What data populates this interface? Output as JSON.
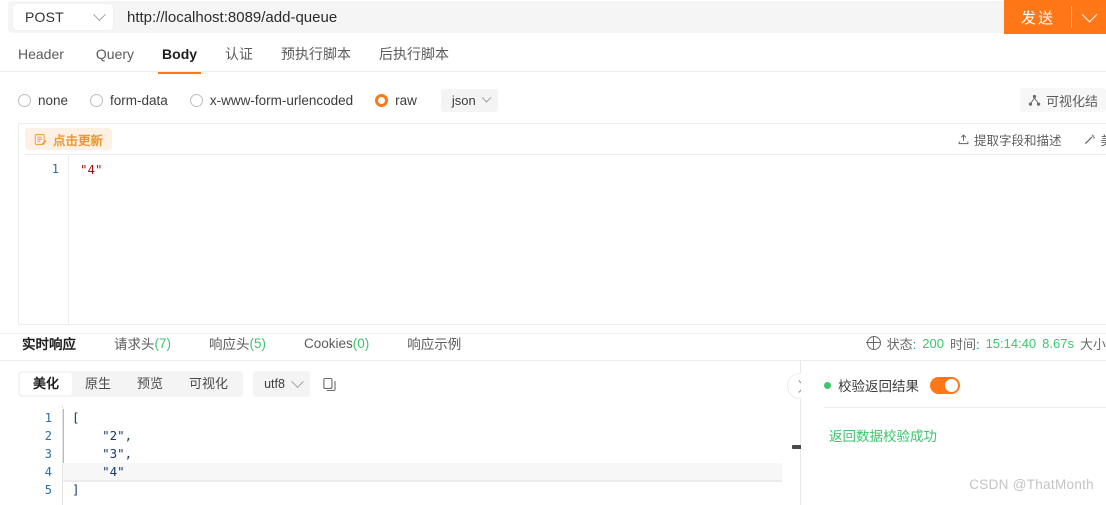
{
  "request": {
    "method": "POST",
    "url": "http://localhost:8089/add-queue",
    "send_label": "发送",
    "tabs": [
      {
        "label": "Header",
        "active": false
      },
      {
        "label": "Query",
        "active": false
      },
      {
        "label": "Body",
        "active": true
      },
      {
        "label": "认证",
        "active": false
      },
      {
        "label": "预执行脚本",
        "active": false
      },
      {
        "label": "后执行脚本",
        "active": false
      }
    ],
    "body_types": [
      {
        "label": "none",
        "selected": false
      },
      {
        "label": "form-data",
        "selected": false
      },
      {
        "label": "x-www-form-urlencoded",
        "selected": false
      },
      {
        "label": "raw",
        "selected": true
      }
    ],
    "raw_format": "json",
    "visualize_result_label": "可视化结",
    "editor": {
      "update_button_label": "点击更新",
      "extract_fields_label": "提取字段和描述",
      "beautify_label": "美",
      "lines": [
        {
          "number": "1",
          "text": "\"4\"",
          "type": "string"
        }
      ]
    }
  },
  "response": {
    "tabs": [
      {
        "label": "实时响应",
        "count": "",
        "active": true
      },
      {
        "label": "请求头",
        "count": "(7)",
        "active": false
      },
      {
        "label": "响应头",
        "count": "(5)",
        "active": false
      },
      {
        "label": "Cookies",
        "count": "(0)",
        "active": false
      },
      {
        "label": "响应示例",
        "count": "",
        "active": false
      }
    ],
    "status": {
      "status_label": "状态:",
      "status_code": "200",
      "time_label": "时间:",
      "time_value": "15:14:40",
      "duration": "8.67s",
      "size_label": "大小"
    },
    "view_modes": [
      {
        "label": "美化",
        "active": true
      },
      {
        "label": "原生",
        "active": false
      },
      {
        "label": "预览",
        "active": false
      },
      {
        "label": "可视化",
        "active": false
      }
    ],
    "encoding": "utf8",
    "body_lines": [
      {
        "number": "1",
        "text": "[",
        "highlight": false
      },
      {
        "number": "2",
        "text": "    \"2\",",
        "highlight": false
      },
      {
        "number": "3",
        "text": "    \"3\",",
        "highlight": false
      },
      {
        "number": "4",
        "text": "    \"4\"",
        "highlight": true
      },
      {
        "number": "5",
        "text": "]",
        "highlight": false
      }
    ]
  },
  "validation": {
    "title": "校验返回结果",
    "toggle_on": true,
    "message": "返回数据校验成功"
  },
  "watermark": "CSDN @ThatMonth",
  "colors": {
    "accent": "#ff7716",
    "success": "#3ec46d",
    "line_number": "#2b6cb0",
    "string": "#a31515"
  }
}
